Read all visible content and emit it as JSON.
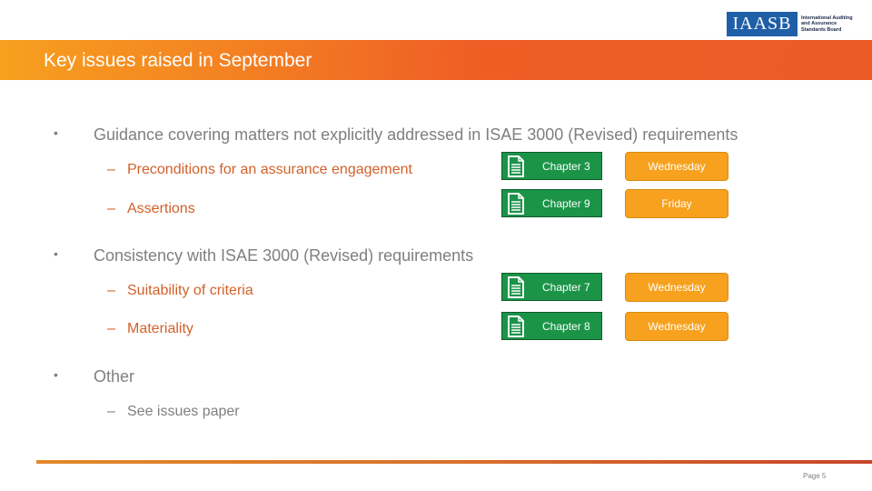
{
  "header": {
    "logo": {
      "mark": "IAASB",
      "subtitle_lines": [
        "International Auditing",
        "and Assurance",
        "Standards Board"
      ]
    },
    "title": "Key issues raised in September"
  },
  "content": {
    "bullets": [
      {
        "text": "Guidance covering matters not explicitly addressed in ISAE 3000 (Revised) requirements",
        "subitems": [
          {
            "text": "Preconditions for an assurance engagement",
            "chapter": "Chapter 3",
            "day": "Wednesday"
          },
          {
            "text": "Assertions",
            "chapter": "Chapter 9",
            "day": "Friday"
          }
        ]
      },
      {
        "text": "Consistency with ISAE 3000 (Revised) requirements",
        "subitems": [
          {
            "text": "Suitability of criteria",
            "chapter": "Chapter 7",
            "day": "Wednesday"
          },
          {
            "text": "Materiality",
            "chapter": "Chapter 8",
            "day": "Wednesday"
          }
        ]
      },
      {
        "text": "Other",
        "subitems": [
          {
            "text": "See issues paper"
          }
        ]
      }
    ],
    "bullet_glyph": "•",
    "dash_glyph": "–"
  },
  "footer": {
    "page_label": "Page 5"
  },
  "colors": {
    "title_gradient_start": "#f7a01f",
    "title_gradient_end": "#ec5a26",
    "chapter_button": "#1b9448",
    "day_button": "#f7a11e",
    "subitem_text": "#d2612a",
    "body_text": "#7f7f7f",
    "logo_blue": "#1f5fa8"
  }
}
